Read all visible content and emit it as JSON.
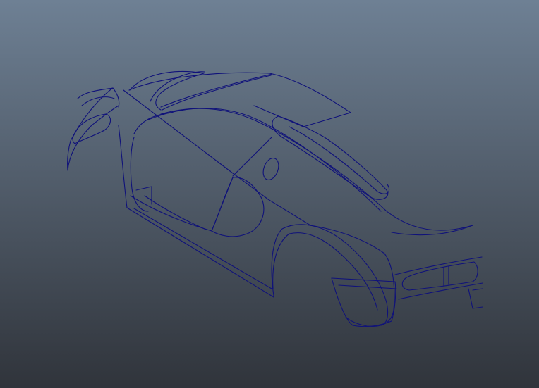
{
  "viewport": {
    "background_top": "#6e8094",
    "background_bottom": "#30343b",
    "wireframe_color": "#10127a"
  },
  "scene": {
    "object": "car-body-nurbs-curves"
  }
}
